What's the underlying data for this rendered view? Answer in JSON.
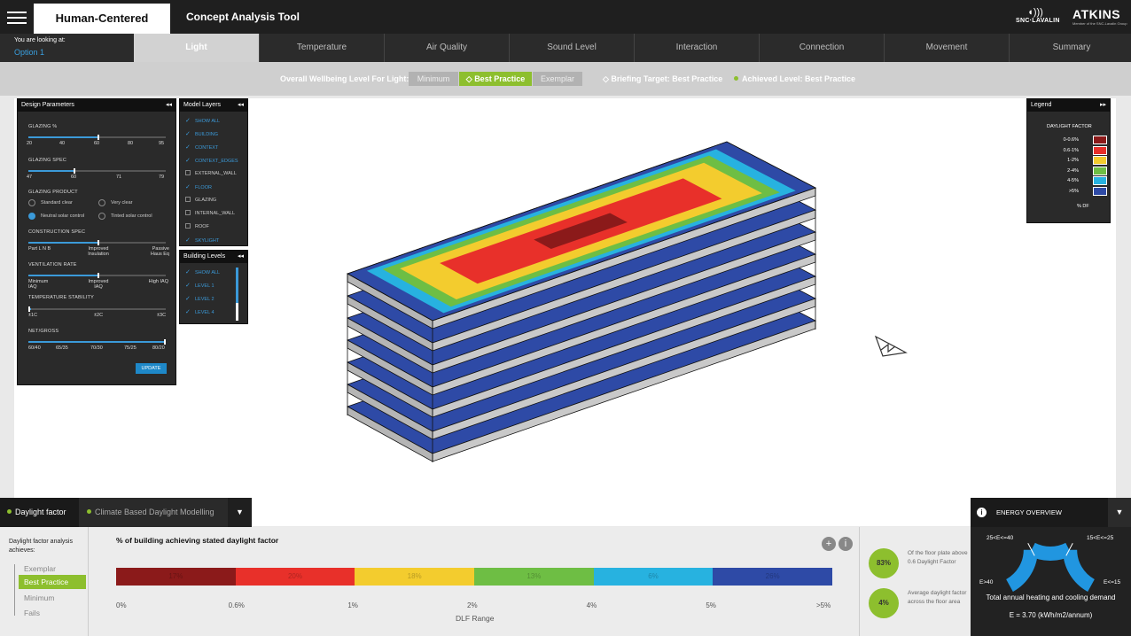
{
  "header": {
    "brand": "Human-Centered Design.",
    "tool_title": "Concept Analysis Tool",
    "logo_snc_text": "SNC·LAVALIN",
    "logo_atkins": "ATKINS",
    "logo_atkins_sub": "Member of the SNC-Lavalin Group"
  },
  "option": {
    "label": "You are looking at:",
    "value": "Option 1"
  },
  "tabs": [
    "Light",
    "Temperature",
    "Air Quality",
    "Sound Level",
    "Interaction",
    "Connection",
    "Movement",
    "Summary"
  ],
  "active_tab": "Light",
  "wellbeing": {
    "label": "Overall Wellbeing Level For Light:",
    "minimum": "Minimum",
    "best": "◇ Best Practice",
    "exemplar": "Exemplar",
    "briefing": "◇ Briefing Target: Best Practice",
    "achieved": "Achieved Level: Best Practice",
    "accent": "#8dbf2e"
  },
  "design_params": {
    "title": "Design Parameters",
    "collapse": "◂◂",
    "glazing_pct": {
      "label": "GLAZING %",
      "ticks": [
        "20",
        "40",
        "60",
        "80",
        "95"
      ]
    },
    "glazing_spec": {
      "label": "GLAZING SPEC",
      "ticks": [
        "47",
        "60",
        "71",
        "79"
      ]
    },
    "glazing_product": {
      "label": "GLAZING PRODUCT",
      "options": [
        "Standard clear",
        "Very clear",
        "Neutral solar control",
        "Tinted solar control"
      ],
      "selected": "Neutral solar control"
    },
    "construction_spec": {
      "label": "CONSTRUCTION SPEC",
      "ticks": [
        "Part L N B",
        "Improved Insulation",
        "Passive Haus Eq"
      ]
    },
    "ventilation_rate": {
      "label": "VENTILATION RATE",
      "ticks": [
        "Minimum IAQ",
        "Improved IAQ",
        "High IAQ"
      ]
    },
    "temperature_stability": {
      "label": "TEMPERATURE STABILITY",
      "ticks": [
        "±1C",
        "±2C",
        "±3C"
      ]
    },
    "net_gross": {
      "label": "NET/GROSS",
      "ticks": [
        "60/40",
        "65/35",
        "70/30",
        "75/25",
        "80/20"
      ]
    },
    "update": "UPDATE"
  },
  "model_layers": {
    "title": "Model Layers",
    "collapse": "◂◂",
    "items": [
      {
        "label": "SHOW ALL",
        "checked": true
      },
      {
        "label": "BUILDING",
        "checked": true
      },
      {
        "label": "CONTEXT",
        "checked": true
      },
      {
        "label": "CONTEXT_EDGES",
        "checked": true
      },
      {
        "label": "EXTERNAL_WALL",
        "checked": false
      },
      {
        "label": "FLOOR",
        "checked": true
      },
      {
        "label": "GLAZING",
        "checked": false
      },
      {
        "label": "INTERNAL_WALL",
        "checked": false
      },
      {
        "label": "ROOF",
        "checked": false
      },
      {
        "label": "SKYLIGHT",
        "checked": true
      }
    ]
  },
  "building_levels": {
    "title": "Building Levels",
    "collapse": "◂◂",
    "items": [
      "SHOW ALL",
      "LEVEL 1",
      "LEVEL 2",
      "LEVEL 4"
    ]
  },
  "legend": {
    "title": "Legend",
    "collapse": "▸▸",
    "heading": "DAYLIGHT FACTOR",
    "unit": "% DF",
    "rows": [
      {
        "label": "0-0.6%",
        "color": "#8b1a1a"
      },
      {
        "label": "0.6-1%",
        "color": "#e8302a"
      },
      {
        "label": "1-2%",
        "color": "#f3cc2e"
      },
      {
        "label": "2-4%",
        "color": "#6ebe44"
      },
      {
        "label": "4-5%",
        "color": "#27b2e0"
      },
      {
        "label": ">5%",
        "color": "#2e4aa6"
      }
    ]
  },
  "bottom_tabs": {
    "daylight": "Daylight factor",
    "cbdm": "Climate Based Daylight Modelling",
    "dropdown": "▼"
  },
  "analysis": {
    "achieves_label": "Daylight factor analysis achieves:",
    "levels": [
      "Exemplar",
      "Best Practice",
      "Minimum",
      "Fails"
    ],
    "current": "Best Practice",
    "bar_title": "% of building achieving stated daylight factor",
    "x_ticks": [
      "0%",
      "0.6%",
      "1%",
      "2%",
      "4%",
      "5%",
      ">5%"
    ],
    "x_label": "DLF Range"
  },
  "chart_data": {
    "type": "bar",
    "title": "% of building achieving stated daylight factor",
    "xlabel": "DLF Range",
    "categories": [
      "0-0.6%",
      "0.6-1%",
      "1-2%",
      "2-4%",
      "4-5%",
      ">5%"
    ],
    "values": [
      17,
      20,
      18,
      13,
      6,
      26
    ],
    "labels": [
      "17%",
      "20%",
      "18%",
      "13%",
      "6%",
      "26%"
    ],
    "colors": [
      "#8b1a1a",
      "#e8302a",
      "#f3cc2e",
      "#6ebe44",
      "#27b2e0",
      "#2e4aa6"
    ]
  },
  "stats": [
    {
      "value": "83%",
      "note": "Of the floor plate above 0.6 Daylight Factor"
    },
    {
      "value": "4%",
      "note": "Average daylight factor across the floor area"
    }
  ],
  "energy": {
    "title": "ENERGY OVERVIEW",
    "info": "i",
    "dropdown": "▼",
    "labels": [
      "25<E<=40",
      "15<E<=25",
      "E>40",
      "E<=15"
    ],
    "desc": "Total annual heating and cooling demand",
    "value": "E = 3.70 (kWh/m2/annum)",
    "color": "#2196e0"
  }
}
